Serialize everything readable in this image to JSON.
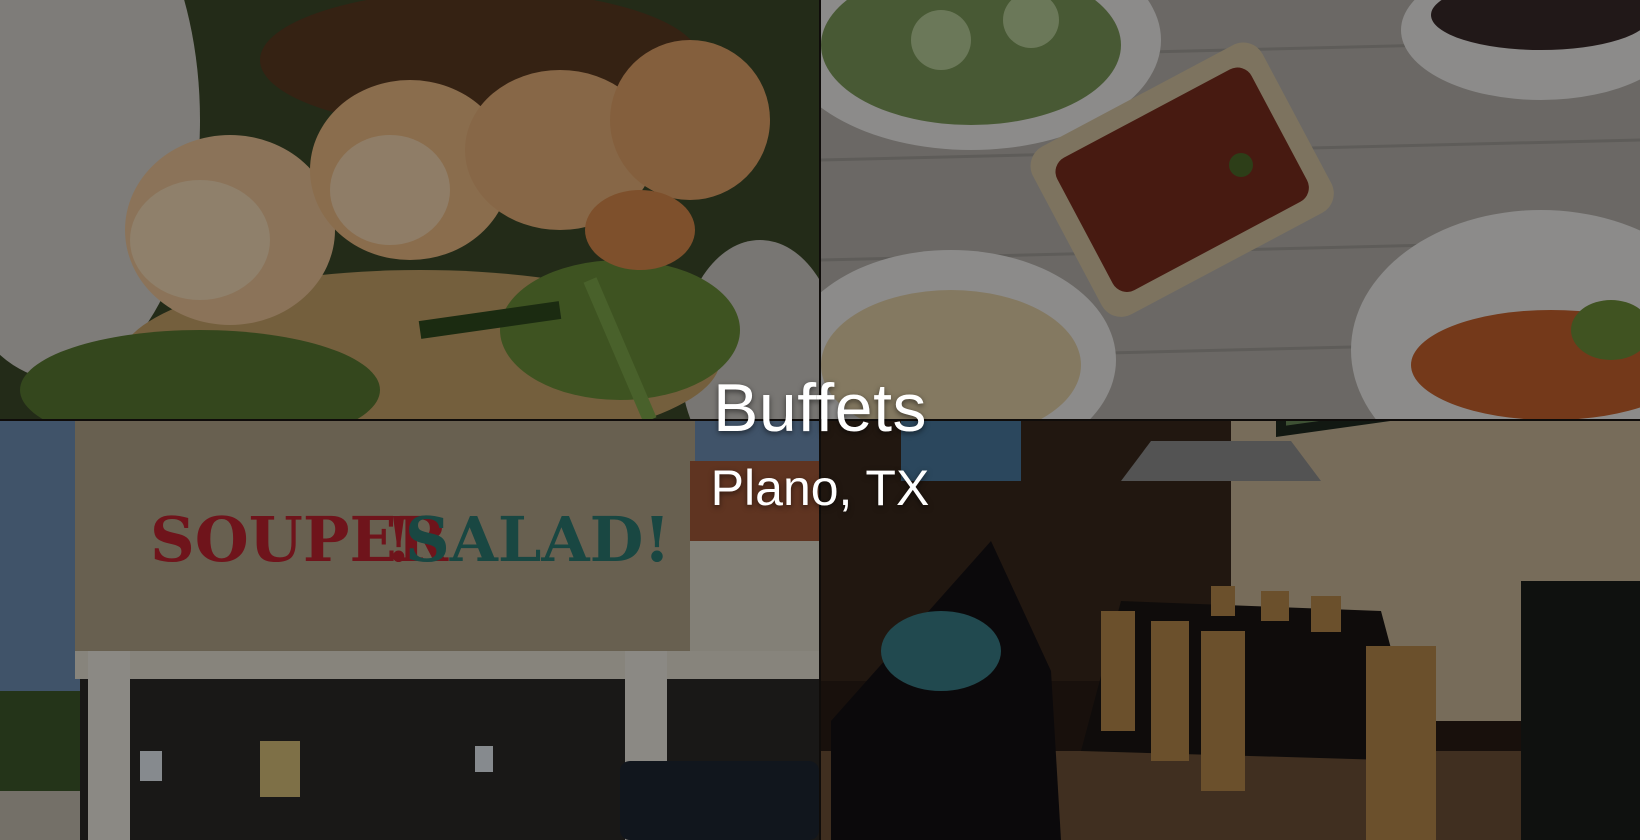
{
  "hero": {
    "title": "Buffets",
    "subtitle": "Plano, TX"
  },
  "images": [
    {
      "name": "grilled-shrimp-salad-photo"
    },
    {
      "name": "food-spread-table-photo"
    },
    {
      "name": "souper-salad-storefront-photo",
      "sign_left": "SOUPER",
      "sign_sep": "!",
      "sign_right": "SALAD!"
    },
    {
      "name": "private-dining-room-photo"
    }
  ],
  "colors": {
    "overlay": "#000000",
    "title_text": "#ffffff",
    "sign_red": "#c0242f",
    "sign_teal": "#2b7a73"
  }
}
